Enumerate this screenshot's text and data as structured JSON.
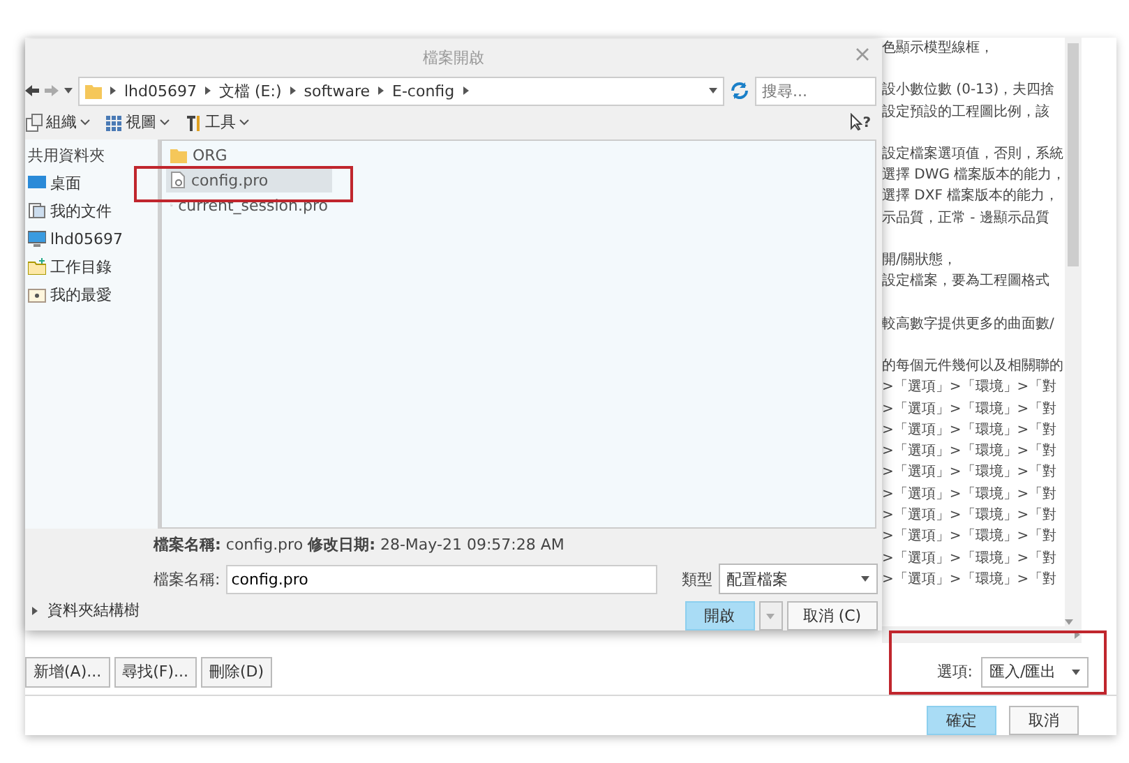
{
  "background_window": {
    "description_paragraphs": [
      [
        "色顯示模型線框，"
      ],
      [
        "設小數位數 (0-13)，夫四捨",
        "設定預設的工程圖比例，該"
      ],
      [
        "設定檔案選項值，否則，系統",
        "選擇 DWG 檔案版本的能力，",
        "選擇 DXF 檔案版本的能力，",
        "示品質，正常 - 邊顯示品質"
      ],
      [
        "開/關狀態，",
        "設定檔案，要為工程圖格式"
      ],
      [
        "較高數字提供更多的曲面數/"
      ],
      [
        "的每個元件幾何以及相關聯的",
        ">「選項」>「環境」>「對",
        ">「選項」>「環境」>「對",
        ">「選項」>「環境」>「對",
        ">「選項」>「環境」>「對",
        ">「選項」>「環境」>「對",
        ">「選項」>「環境」>「對",
        ">「選項」>「環境」>「對",
        ">「選項」>「環境」>「對",
        ">「選項」>「環境」>「對",
        ">「選項」>「環境」>「對"
      ]
    ],
    "list_buttons": [
      "新增(A)...",
      "尋找(F)...",
      "刪除(D)"
    ],
    "options": {
      "label": "選項:",
      "value": "匯入/匯出"
    },
    "buttons": [
      {
        "label": "確定",
        "primary": true
      },
      {
        "label": "取消",
        "primary": false
      }
    ]
  },
  "file_dialog": {
    "title": "檔案開啟",
    "path": [
      "lhd05697",
      "文檔 (E:)",
      "software",
      "E-config"
    ],
    "search": {
      "placeholder": "搜尋..."
    },
    "help_mark": "?",
    "toolbar": [
      {
        "label": "組織",
        "kind": "organize"
      },
      {
        "label": "視圖",
        "kind": "view"
      },
      {
        "label": "工具",
        "kind": "tools"
      }
    ],
    "sidebar": {
      "header": "共用資料夾",
      "items": [
        {
          "label": "桌面",
          "kind": "desktop"
        },
        {
          "label": "我的文件",
          "kind": "documents"
        },
        {
          "label": "lhd05697",
          "kind": "computer"
        },
        {
          "label": "工作目錄",
          "kind": "workdir"
        },
        {
          "label": "我的最愛",
          "kind": "favorites"
        }
      ],
      "tree_label": "資料夾結構樹"
    },
    "files": [
      {
        "name": "ORG",
        "kind": "folder",
        "selected": false
      },
      {
        "name": "config.pro",
        "kind": "file",
        "selected": true
      },
      {
        "name": "current_session.pro",
        "kind": "file",
        "selected": false
      }
    ],
    "info": "**檔案名稱:** config.pro  **修改日期:** 28-May-21 09:57:28 AM",
    "file_name": {
      "label": "檔案名稱:",
      "value": "config.pro"
    },
    "file_type": {
      "label": "類型",
      "value": "配置檔案"
    },
    "buttons": [
      {
        "label": "開啟",
        "primary": true
      },
      {
        "label": "取消 (C)",
        "primary": false
      }
    ]
  }
}
